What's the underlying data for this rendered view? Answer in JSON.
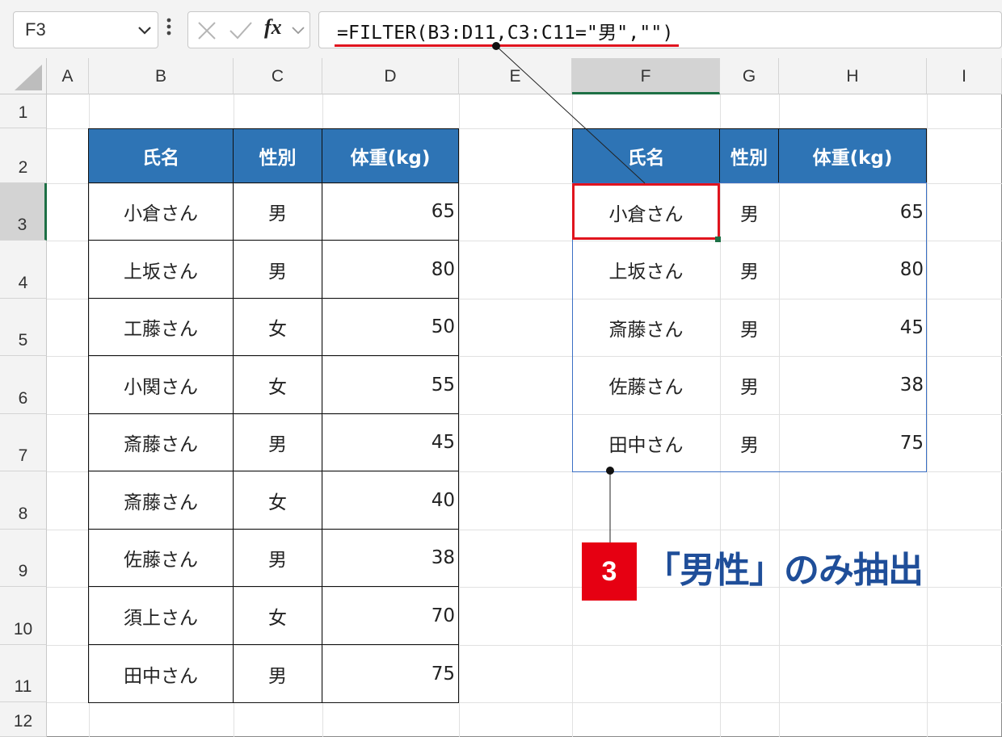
{
  "formula_bar": {
    "name_box": "F3",
    "fx_label": "fx",
    "formula": "=FILTER(B3:D11,C3:C11=\"男\",\"\")"
  },
  "columns": [
    "A",
    "B",
    "C",
    "D",
    "E",
    "F",
    "G",
    "H",
    "I"
  ],
  "rows": [
    "1",
    "2",
    "3",
    "4",
    "5",
    "6",
    "7",
    "8",
    "9",
    "10",
    "11",
    "12"
  ],
  "source_table": {
    "headers": [
      "氏名",
      "性別",
      "体重(kg)"
    ],
    "rows": [
      [
        "小倉さん",
        "男",
        "65"
      ],
      [
        "上坂さん",
        "男",
        "80"
      ],
      [
        "工藤さん",
        "女",
        "50"
      ],
      [
        "小関さん",
        "女",
        "55"
      ],
      [
        "斎藤さん",
        "男",
        "45"
      ],
      [
        "斎藤さん",
        "女",
        "40"
      ],
      [
        "佐藤さん",
        "男",
        "38"
      ],
      [
        "須上さん",
        "女",
        "70"
      ],
      [
        "田中さん",
        "男",
        "75"
      ]
    ]
  },
  "result_table": {
    "headers": [
      "氏名",
      "性別",
      "体重(kg)"
    ],
    "rows": [
      [
        "小倉さん",
        "男",
        "65"
      ],
      [
        "上坂さん",
        "男",
        "80"
      ],
      [
        "斎藤さん",
        "男",
        "45"
      ],
      [
        "佐藤さん",
        "男",
        "38"
      ],
      [
        "田中さん",
        "男",
        "75"
      ]
    ]
  },
  "callout": {
    "step_number": "3",
    "text": "「男性」のみ抽出"
  },
  "colors": {
    "header_fill": "#2e74b5",
    "accent_red": "#e60012",
    "callout_text": "#1f4e99",
    "selection_green": "#1d7045"
  }
}
